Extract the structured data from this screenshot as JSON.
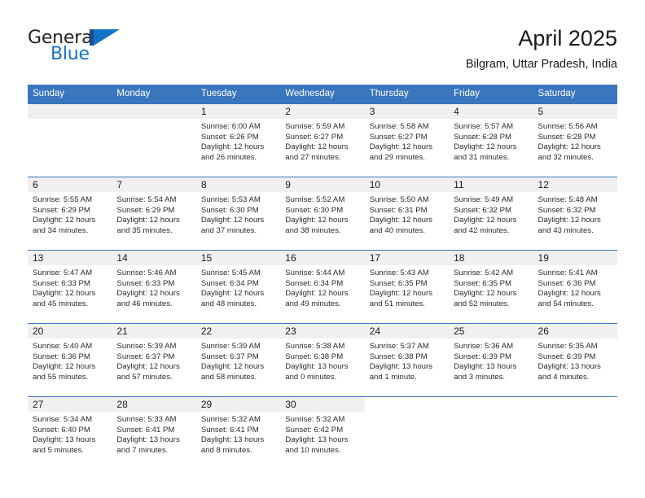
{
  "brand": {
    "name_part1": "General",
    "name_part2": "Blue",
    "mark": "triangle-logo"
  },
  "header": {
    "title": "April 2025",
    "subtitle": "Bilgram, Uttar Pradesh, India"
  },
  "colors": {
    "header_blue": "#3a76bd",
    "brand_blue": "#1473c6",
    "brand_dark_blue": "#1b4f87",
    "daynum_band": "#f0f0f0",
    "text": "#1a1a1a"
  },
  "calendar": {
    "weekday_headers": [
      "Sunday",
      "Monday",
      "Tuesday",
      "Wednesday",
      "Thursday",
      "Friday",
      "Saturday"
    ],
    "weeks": [
      [
        {
          "day": "",
          "empty": true
        },
        {
          "day": "",
          "empty": true
        },
        {
          "day": "1",
          "sunrise": "Sunrise: 6:00 AM",
          "sunset": "Sunset: 6:26 PM",
          "daylight": "Daylight: 12 hours and 26 minutes."
        },
        {
          "day": "2",
          "sunrise": "Sunrise: 5:59 AM",
          "sunset": "Sunset: 6:27 PM",
          "daylight": "Daylight: 12 hours and 27 minutes."
        },
        {
          "day": "3",
          "sunrise": "Sunrise: 5:58 AM",
          "sunset": "Sunset: 6:27 PM",
          "daylight": "Daylight: 12 hours and 29 minutes."
        },
        {
          "day": "4",
          "sunrise": "Sunrise: 5:57 AM",
          "sunset": "Sunset: 6:28 PM",
          "daylight": "Daylight: 12 hours and 31 minutes."
        },
        {
          "day": "5",
          "sunrise": "Sunrise: 5:56 AM",
          "sunset": "Sunset: 6:28 PM",
          "daylight": "Daylight: 12 hours and 32 minutes."
        }
      ],
      [
        {
          "day": "6",
          "sunrise": "Sunrise: 5:55 AM",
          "sunset": "Sunset: 6:29 PM",
          "daylight": "Daylight: 12 hours and 34 minutes."
        },
        {
          "day": "7",
          "sunrise": "Sunrise: 5:54 AM",
          "sunset": "Sunset: 6:29 PM",
          "daylight": "Daylight: 12 hours and 35 minutes."
        },
        {
          "day": "8",
          "sunrise": "Sunrise: 5:53 AM",
          "sunset": "Sunset: 6:30 PM",
          "daylight": "Daylight: 12 hours and 37 minutes."
        },
        {
          "day": "9",
          "sunrise": "Sunrise: 5:52 AM",
          "sunset": "Sunset: 6:30 PM",
          "daylight": "Daylight: 12 hours and 38 minutes."
        },
        {
          "day": "10",
          "sunrise": "Sunrise: 5:50 AM",
          "sunset": "Sunset: 6:31 PM",
          "daylight": "Daylight: 12 hours and 40 minutes."
        },
        {
          "day": "11",
          "sunrise": "Sunrise: 5:49 AM",
          "sunset": "Sunset: 6:32 PM",
          "daylight": "Daylight: 12 hours and 42 minutes."
        },
        {
          "day": "12",
          "sunrise": "Sunrise: 5:48 AM",
          "sunset": "Sunset: 6:32 PM",
          "daylight": "Daylight: 12 hours and 43 minutes."
        }
      ],
      [
        {
          "day": "13",
          "sunrise": "Sunrise: 5:47 AM",
          "sunset": "Sunset: 6:33 PM",
          "daylight": "Daylight: 12 hours and 45 minutes."
        },
        {
          "day": "14",
          "sunrise": "Sunrise: 5:46 AM",
          "sunset": "Sunset: 6:33 PM",
          "daylight": "Daylight: 12 hours and 46 minutes."
        },
        {
          "day": "15",
          "sunrise": "Sunrise: 5:45 AM",
          "sunset": "Sunset: 6:34 PM",
          "daylight": "Daylight: 12 hours and 48 minutes."
        },
        {
          "day": "16",
          "sunrise": "Sunrise: 5:44 AM",
          "sunset": "Sunset: 6:34 PM",
          "daylight": "Daylight: 12 hours and 49 minutes."
        },
        {
          "day": "17",
          "sunrise": "Sunrise: 5:43 AM",
          "sunset": "Sunset: 6:35 PM",
          "daylight": "Daylight: 12 hours and 51 minutes."
        },
        {
          "day": "18",
          "sunrise": "Sunrise: 5:42 AM",
          "sunset": "Sunset: 6:35 PM",
          "daylight": "Daylight: 12 hours and 52 minutes."
        },
        {
          "day": "19",
          "sunrise": "Sunrise: 5:41 AM",
          "sunset": "Sunset: 6:36 PM",
          "daylight": "Daylight: 12 hours and 54 minutes."
        }
      ],
      [
        {
          "day": "20",
          "sunrise": "Sunrise: 5:40 AM",
          "sunset": "Sunset: 6:36 PM",
          "daylight": "Daylight: 12 hours and 55 minutes."
        },
        {
          "day": "21",
          "sunrise": "Sunrise: 5:39 AM",
          "sunset": "Sunset: 6:37 PM",
          "daylight": "Daylight: 12 hours and 57 minutes."
        },
        {
          "day": "22",
          "sunrise": "Sunrise: 5:39 AM",
          "sunset": "Sunset: 6:37 PM",
          "daylight": "Daylight: 12 hours and 58 minutes."
        },
        {
          "day": "23",
          "sunrise": "Sunrise: 5:38 AM",
          "sunset": "Sunset: 6:38 PM",
          "daylight": "Daylight: 13 hours and 0 minutes."
        },
        {
          "day": "24",
          "sunrise": "Sunrise: 5:37 AM",
          "sunset": "Sunset: 6:38 PM",
          "daylight": "Daylight: 13 hours and 1 minute."
        },
        {
          "day": "25",
          "sunrise": "Sunrise: 5:36 AM",
          "sunset": "Sunset: 6:39 PM",
          "daylight": "Daylight: 13 hours and 3 minutes."
        },
        {
          "day": "26",
          "sunrise": "Sunrise: 5:35 AM",
          "sunset": "Sunset: 6:39 PM",
          "daylight": "Daylight: 13 hours and 4 minutes."
        }
      ],
      [
        {
          "day": "27",
          "sunrise": "Sunrise: 5:34 AM",
          "sunset": "Sunset: 6:40 PM",
          "daylight": "Daylight: 13 hours and 5 minutes."
        },
        {
          "day": "28",
          "sunrise": "Sunrise: 5:33 AM",
          "sunset": "Sunset: 6:41 PM",
          "daylight": "Daylight: 13 hours and 7 minutes."
        },
        {
          "day": "29",
          "sunrise": "Sunrise: 5:32 AM",
          "sunset": "Sunset: 6:41 PM",
          "daylight": "Daylight: 13 hours and 8 minutes."
        },
        {
          "day": "30",
          "sunrise": "Sunrise: 5:32 AM",
          "sunset": "Sunset: 6:42 PM",
          "daylight": "Daylight: 13 hours and 10 minutes."
        },
        {
          "day": "",
          "empty": true,
          "blank": true
        },
        {
          "day": "",
          "empty": true,
          "blank": true
        },
        {
          "day": "",
          "empty": true,
          "blank": true
        }
      ]
    ]
  }
}
